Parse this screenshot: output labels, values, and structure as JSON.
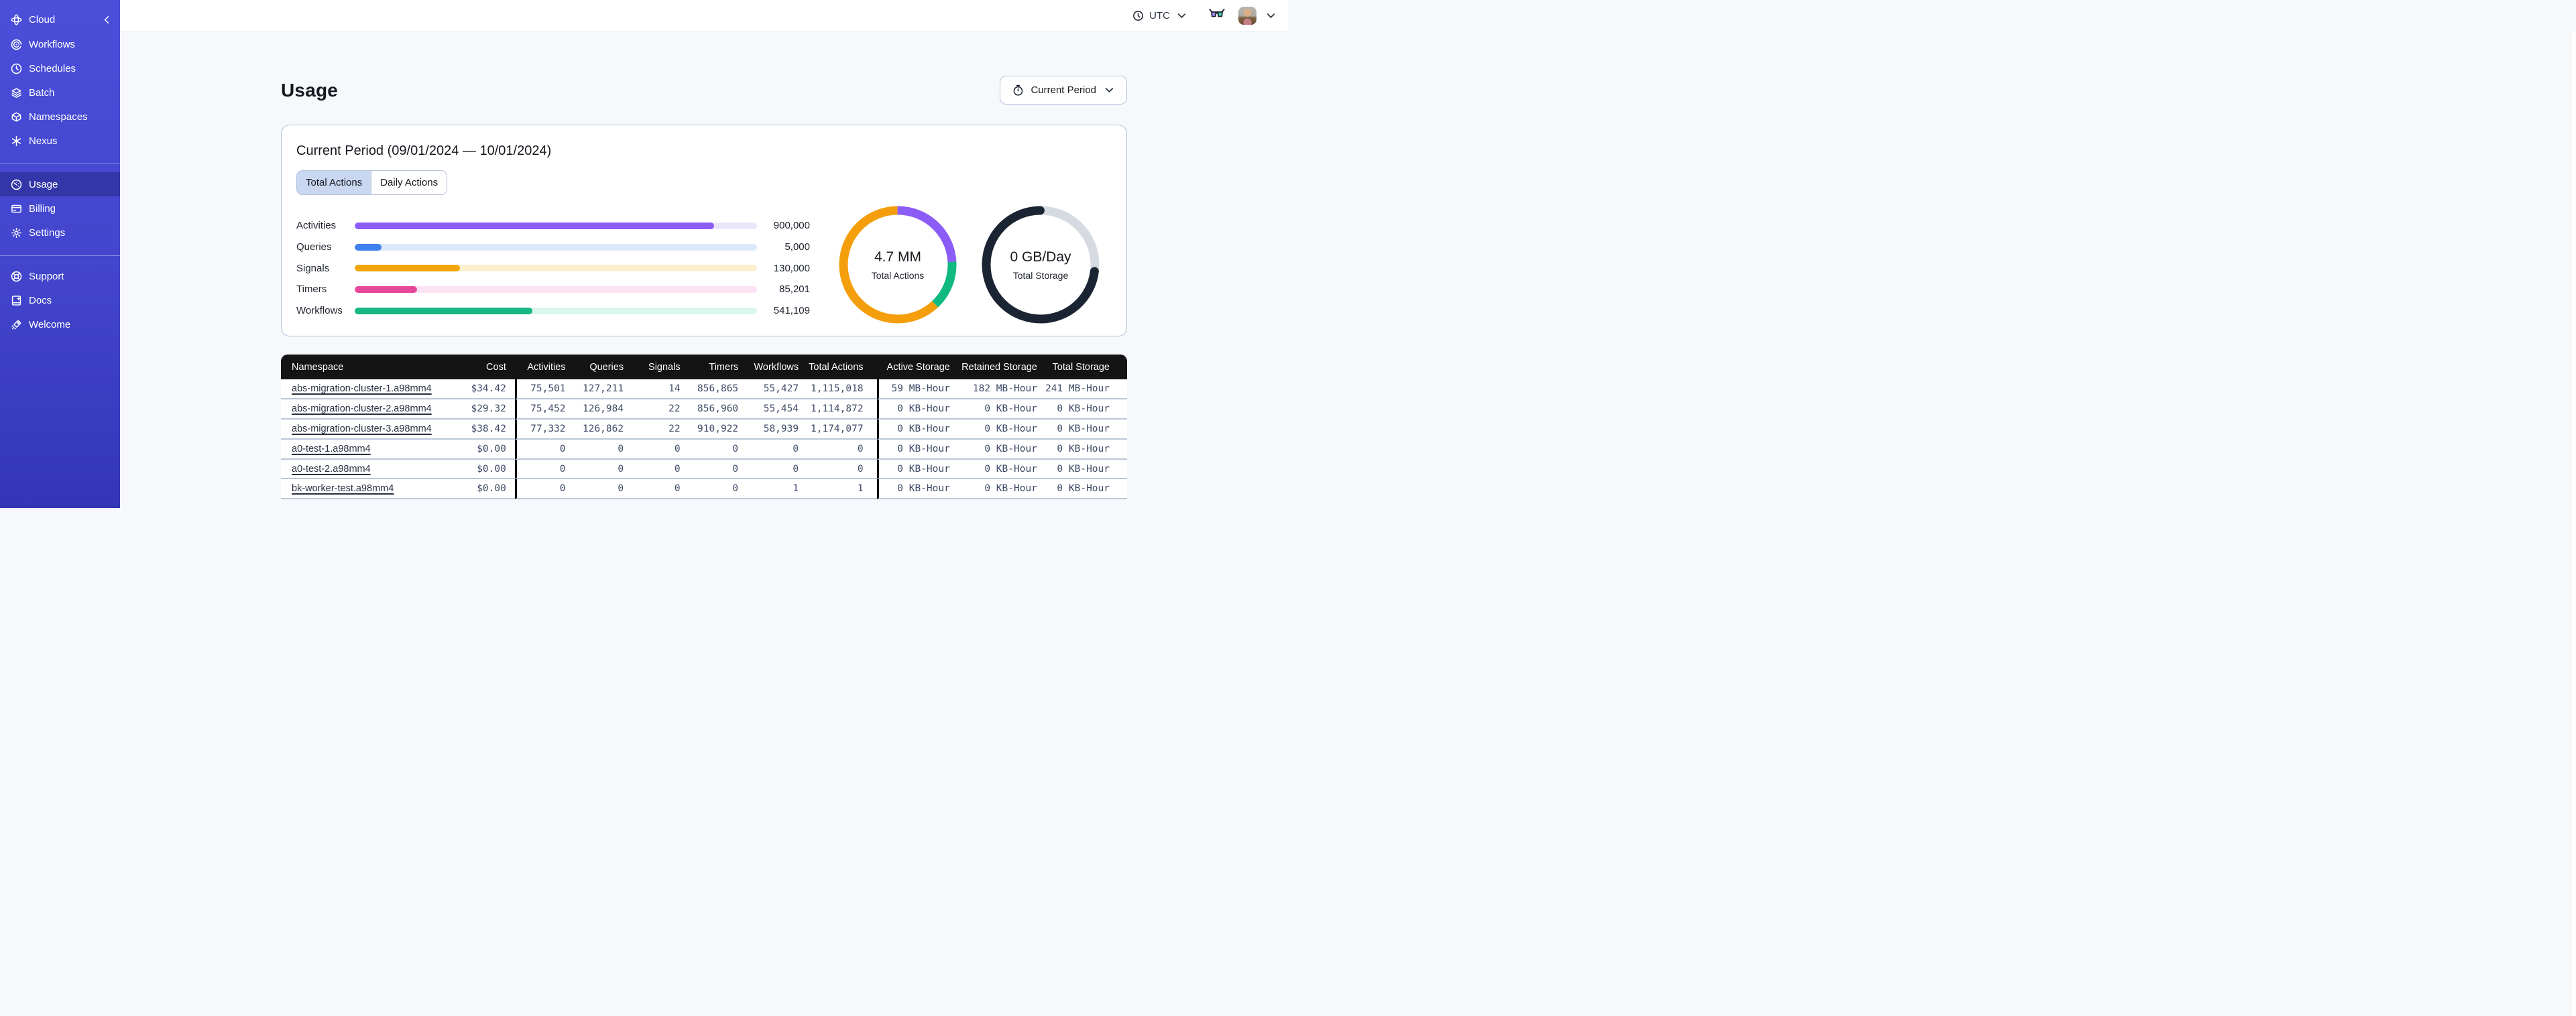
{
  "sidebar": {
    "brand": {
      "label": "Cloud",
      "icon": "temporal-logo-icon"
    },
    "collapse_icon": "chevron-left-icon",
    "groups": [
      {
        "items": [
          {
            "label": "Workflows",
            "icon": "workflows-icon",
            "active": false
          },
          {
            "label": "Schedules",
            "icon": "schedules-icon",
            "active": false
          },
          {
            "label": "Batch",
            "icon": "batch-icon",
            "active": false
          },
          {
            "label": "Namespaces",
            "icon": "namespaces-icon",
            "active": false
          },
          {
            "label": "Nexus",
            "icon": "nexus-icon",
            "active": false
          }
        ]
      },
      {
        "items": [
          {
            "label": "Usage",
            "icon": "gauge-icon",
            "active": true
          },
          {
            "label": "Billing",
            "icon": "credit-card-icon",
            "active": false
          },
          {
            "label": "Settings",
            "icon": "gear-icon",
            "active": false
          }
        ]
      },
      {
        "items": [
          {
            "label": "Support",
            "icon": "lifebuoy-icon",
            "active": false
          },
          {
            "label": "Docs",
            "icon": "book-icon",
            "active": false
          },
          {
            "label": "Welcome",
            "icon": "rocket-icon",
            "active": false
          }
        ]
      }
    ]
  },
  "topbar": {
    "timezone": "UTC",
    "icons": [
      "clock-icon",
      "chevron-down-icon",
      "glasses-icon",
      "avatar",
      "chevron-down-icon"
    ]
  },
  "page": {
    "title": "Usage",
    "period_button_label": "Current Period"
  },
  "panel": {
    "title": "Current Period (09/01/2024 — 10/01/2024)",
    "tabs": [
      {
        "label": "Total Actions",
        "active": true
      },
      {
        "label": "Daily Actions",
        "active": false
      }
    ]
  },
  "chart_data": [
    {
      "type": "bar",
      "orientation": "horizontal",
      "categories": [
        "Activities",
        "Queries",
        "Signals",
        "Timers",
        "Workflows"
      ],
      "values": [
        900000,
        5000,
        130000,
        85201,
        541109
      ],
      "display_values": [
        "900,000",
        "5,000",
        "130,000",
        "85,201",
        "541,109"
      ],
      "fill_fractions": [
        0.894,
        0.067,
        0.261,
        0.155,
        0.441
      ],
      "colors": [
        "#8B5CF6",
        "#4080EE",
        "#F2A60D",
        "#E8489B",
        "#16B685"
      ],
      "track_colors": [
        "#ECE6FB",
        "#DCE9FB",
        "#FBF0CE",
        "#FBE3F4",
        "#D9F7EA"
      ]
    },
    {
      "type": "donut",
      "center_value": "4.7 MM",
      "center_label": "Total Actions",
      "segments": [
        {
          "name": "activities",
          "color": "#8B5CF6",
          "fraction": 0.242
        },
        {
          "name": "workflows",
          "color": "#10B981",
          "fraction": 0.138
        },
        {
          "name": "other",
          "color": "#F59E0B",
          "fraction": 0.62
        }
      ]
    },
    {
      "type": "donut",
      "center_value": "0 GB/Day",
      "center_label": "Total Storage",
      "segments": [
        {
          "name": "track",
          "color": "#D6DAE1",
          "fraction": 0.27,
          "cap": "butt"
        },
        {
          "name": "storage",
          "color": "#1B2433",
          "fraction": 0.73,
          "cap": "round"
        }
      ]
    }
  ],
  "table": {
    "columns": [
      {
        "label": "Namespace",
        "divider_before": false
      },
      {
        "label": "Cost",
        "divider_before": false
      },
      {
        "label": "Activities",
        "divider_before": true
      },
      {
        "label": "Queries",
        "divider_before": false
      },
      {
        "label": "Signals",
        "divider_before": false
      },
      {
        "label": "Timers",
        "divider_before": false
      },
      {
        "label": "Workflows",
        "divider_before": false
      },
      {
        "label": "Total Actions",
        "divider_before": false
      },
      {
        "label": "Active Storage",
        "divider_before": true
      },
      {
        "label": "Retained Storage",
        "divider_before": false
      },
      {
        "label": "Total Storage",
        "divider_before": false
      }
    ],
    "rows": [
      [
        "abs-migration-cluster-1.a98mm4",
        "$34.42",
        "75,501",
        "127,211",
        "14",
        "856,865",
        "55,427",
        "1,115,018",
        "59 MB-Hour",
        "182 MB-Hour",
        "241 MB-Hour"
      ],
      [
        "abs-migration-cluster-2.a98mm4",
        "$29.32",
        "75,452",
        "126,984",
        "22",
        "856,960",
        "55,454",
        "1,114,872",
        "0 KB-Hour",
        "0 KB-Hour",
        "0 KB-Hour"
      ],
      [
        "abs-migration-cluster-3.a98mm4",
        "$38.42",
        "77,332",
        "126,862",
        "22",
        "910,922",
        "58,939",
        "1,174,077",
        "0 KB-Hour",
        "0 KB-Hour",
        "0 KB-Hour"
      ],
      [
        "a0-test-1.a98mm4",
        "$0.00",
        "0",
        "0",
        "0",
        "0",
        "0",
        "0",
        "0 KB-Hour",
        "0 KB-Hour",
        "0 KB-Hour"
      ],
      [
        "a0-test-2.a98mm4",
        "$0.00",
        "0",
        "0",
        "0",
        "0",
        "0",
        "0",
        "0 KB-Hour",
        "0 KB-Hour",
        "0 KB-Hour"
      ],
      [
        "bk-worker-test.a98mm4",
        "$0.00",
        "0",
        "0",
        "0",
        "0",
        "1",
        "1",
        "0 KB-Hour",
        "0 KB-Hour",
        "0 KB-Hour"
      ]
    ]
  }
}
